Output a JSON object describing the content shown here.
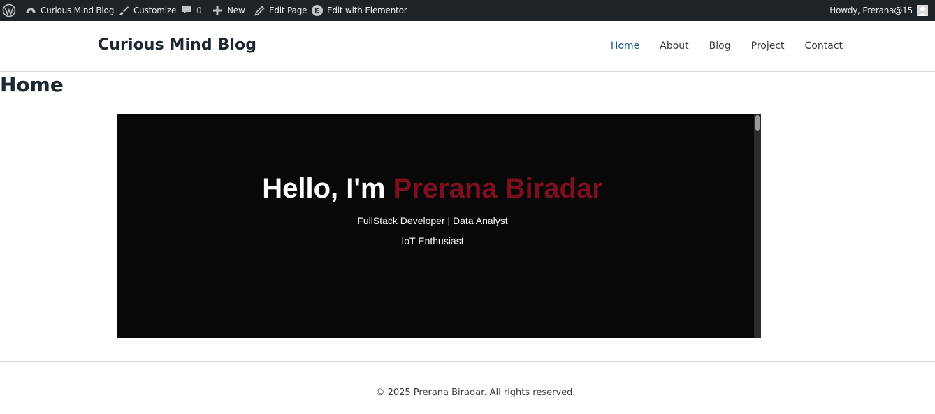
{
  "admin_bar": {
    "site_name": "Curious Mind Blog",
    "customize": "Customize",
    "comments_count": "0",
    "new": "New",
    "edit_page": "Edit Page",
    "edit_elementor": "Edit with Elementor",
    "greeting": "Howdy, Prerana@15",
    "icons": [
      "wordpress-logo-icon",
      "dashboard-icon",
      "brush-icon",
      "comment-icon",
      "plus-icon",
      "pencil-icon",
      "elementor-icon",
      "avatar"
    ]
  },
  "header": {
    "site_title": "Curious Mind Blog",
    "nav": [
      {
        "label": "Home",
        "active": true
      },
      {
        "label": "About",
        "active": false
      },
      {
        "label": "Blog",
        "active": false
      },
      {
        "label": "Project",
        "active": false
      },
      {
        "label": "Contact",
        "active": false
      }
    ]
  },
  "page": {
    "title": "Home"
  },
  "hero": {
    "greeting": "Hello, I'm",
    "name": "Prerana Biradar",
    "subtitle_1": "FullStack Developer | Data Analyst",
    "subtitle_2": "IoT Enthusiast",
    "name_color": "#7d0f1e",
    "background": "#080808"
  },
  "footer": {
    "text": "© 2025 Prerana Biradar. All rights reserved."
  },
  "colors": {
    "admin_bar_bg": "#1d2327",
    "nav_active": "#1a5a8a",
    "title": "#1e2833"
  }
}
